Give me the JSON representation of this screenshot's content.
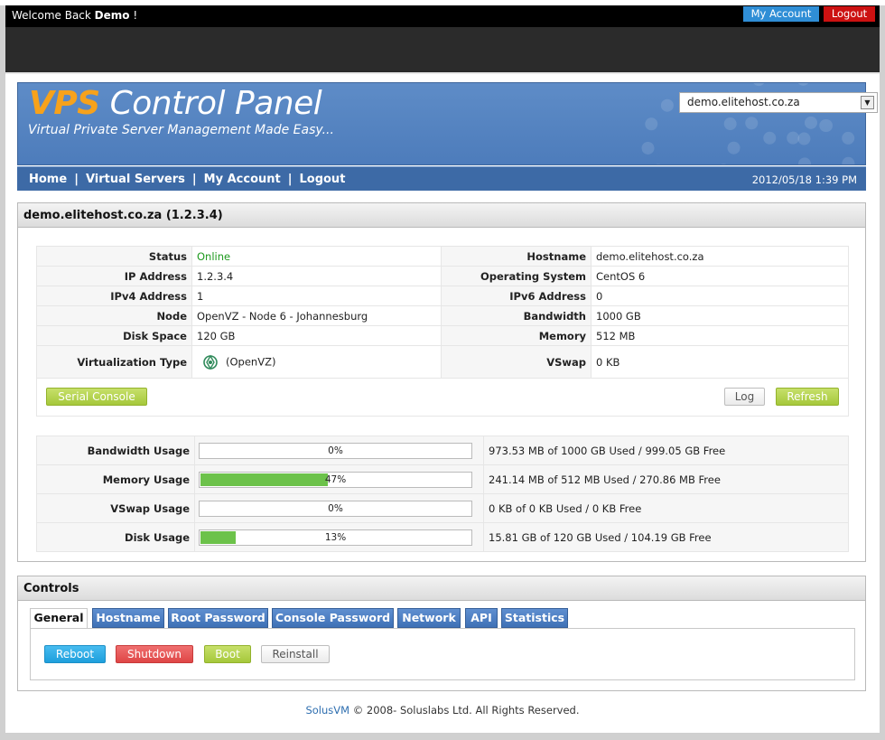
{
  "topbar": {
    "welcome_prefix": "Welcome Back",
    "user": "Demo",
    "welcome_suffix": " !",
    "my_account": "My Account",
    "logout": "Logout"
  },
  "header": {
    "title_accent": "VPS",
    "title_rest": " Control Panel",
    "subtitle": "Virtual Private Server Management Made Easy...",
    "server_select": "demo.elitehost.co.za"
  },
  "nav": {
    "items": [
      "Home",
      "Virtual Servers",
      "My Account",
      "Logout"
    ],
    "datetime": "2012/05/18 1:39 PM"
  },
  "server": {
    "heading": "demo.elitehost.co.za (1.2.3.4)",
    "left": [
      {
        "label": "Status",
        "value": "Online"
      },
      {
        "label": "IP Address",
        "value": "1.2.3.4"
      },
      {
        "label": "IPv4 Address",
        "value": "1"
      },
      {
        "label": "Node",
        "value": "OpenVZ - Node 6 - Johannesburg"
      },
      {
        "label": "Disk Space",
        "value": "120 GB"
      },
      {
        "label": "Virtualization Type",
        "value": "(OpenVZ)"
      }
    ],
    "right": [
      {
        "label": "Hostname",
        "value": "demo.elitehost.co.za"
      },
      {
        "label": "Operating System",
        "value": "CentOS 6"
      },
      {
        "label": "IPv6 Address",
        "value": "0"
      },
      {
        "label": "Bandwidth",
        "value": "1000 GB"
      },
      {
        "label": "Memory",
        "value": "512 MB"
      },
      {
        "label": "VSwap",
        "value": "0 KB"
      }
    ],
    "buttons": {
      "serial_console": "Serial Console",
      "log": "Log",
      "refresh": "Refresh"
    }
  },
  "usage": [
    {
      "label": "Bandwidth Usage",
      "percent": 0,
      "percent_text": "0%",
      "detail": "973.53 MB of 1000 GB Used / 999.05 GB Free"
    },
    {
      "label": "Memory Usage",
      "percent": 47,
      "percent_text": "47%",
      "detail": "241.14 MB of 512 MB Used / 270.86 MB Free"
    },
    {
      "label": "VSwap Usage",
      "percent": 0,
      "percent_text": "0%",
      "detail": "0 KB of 0 KB Used / 0 KB Free"
    },
    {
      "label": "Disk Usage",
      "percent": 13,
      "percent_text": "13%",
      "detail": "15.81 GB of 120 GB Used / 104.19 GB Free"
    }
  ],
  "controls": {
    "heading": "Controls",
    "tabs": [
      "General",
      "Hostname",
      "Root Password",
      "Console Password",
      "Network",
      "API",
      "Statistics"
    ],
    "active_tab": "General",
    "buttons": {
      "reboot": "Reboot",
      "shutdown": "Shutdown",
      "boot": "Boot",
      "reinstall": "Reinstall"
    }
  },
  "footer": {
    "brand": "SolusVM",
    "text": " © 2008- Soluslabs Ltd. All Rights Reserved."
  },
  "colors": {
    "online": "#1e9a1e",
    "nav_bg": "#3d6aa6",
    "banner_bg": "#5e8cc7",
    "accent_orange": "#f7a21b",
    "progress_fill": "#6cc24a"
  }
}
